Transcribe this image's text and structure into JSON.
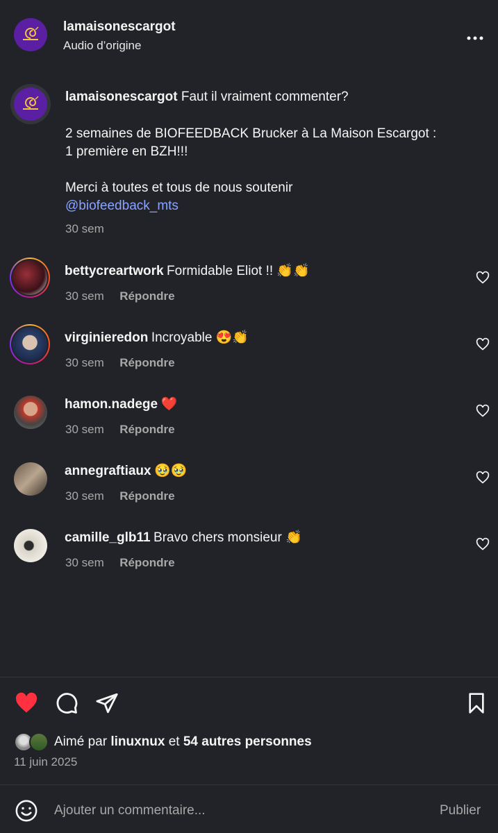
{
  "header": {
    "username": "lamaisonescargot",
    "subtitle": "Audio d’origine"
  },
  "caption": {
    "username": "lamaisonescargot",
    "text_line1": "Faut il vraiment commenter?",
    "text_line2": "2 semaines de BIOFEEDBACK Brucker à La Maison Escargot :",
    "text_line3": "1 première en BZH!!!",
    "text_line4": "Merci à toutes et tous de nous soutenir",
    "mention": "@biofeedback_mts",
    "time": "30 sem"
  },
  "comments": [
    {
      "username": "bettycreartwork",
      "text": "Formidable Eliot !! 👏👏",
      "time": "30 sem",
      "reply": "Répondre"
    },
    {
      "username": "virginieredon",
      "text": "Incroyable 😍👏",
      "time": "30 sem",
      "reply": "Répondre"
    },
    {
      "username": "hamon.nadege",
      "text": "❤️",
      "time": "30 sem",
      "reply": "Répondre"
    },
    {
      "username": "annegraftiaux",
      "text": "🥹🥹",
      "time": "30 sem",
      "reply": "Répondre"
    },
    {
      "username": "camille_glb11",
      "text": "Bravo chers monsieur 👏",
      "time": "30 sem",
      "reply": "Répondre"
    }
  ],
  "likes": {
    "prefix": "Aimé par",
    "user": "linuxnux",
    "connector": "et",
    "others": "54 autres personnes",
    "date": "11 juin 2025"
  },
  "comment_box": {
    "placeholder": "Ajouter un commentaire...",
    "publish": "Publier"
  },
  "colors": {
    "background": "#212328",
    "like_red": "#ff3040",
    "link_blue": "#8aa4ff",
    "muted": "#a8a8a8"
  }
}
